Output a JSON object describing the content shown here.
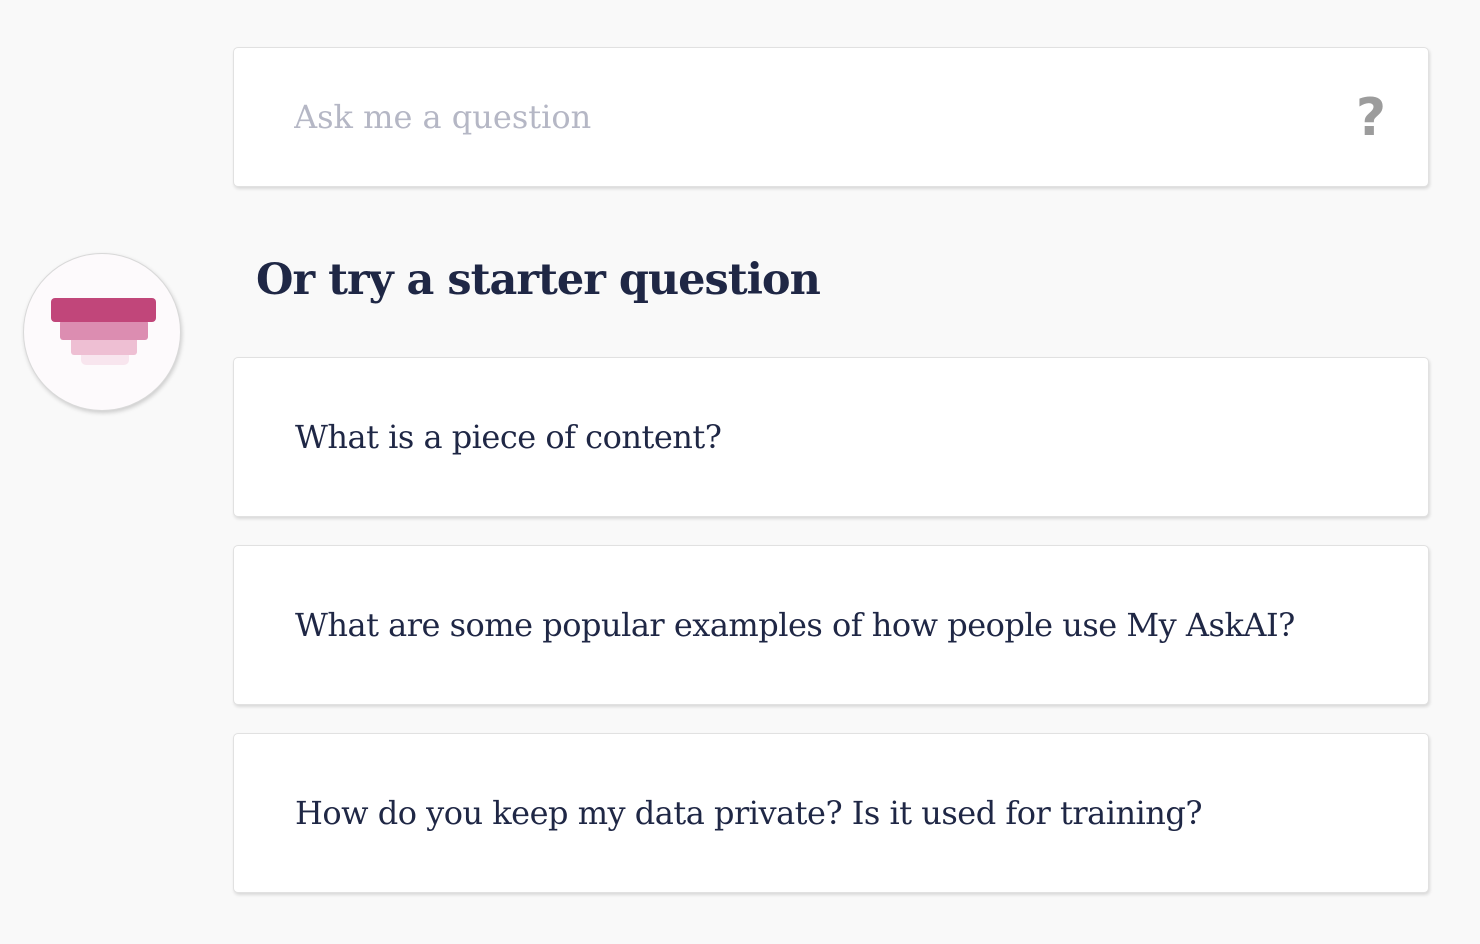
{
  "search": {
    "placeholder": "Ask me a question",
    "value": "",
    "help_icon": "?"
  },
  "avatar": {
    "icon": "stacked-layers-logo-icon",
    "colors": [
      "#c1467a",
      "#dc8db1",
      "#eebfd3",
      "#f8e5ee"
    ]
  },
  "starter": {
    "heading": "Or try a starter question",
    "questions": [
      "What is a piece of content?",
      "What are some popular examples of how people use My AskAI?",
      "How do you keep my data private? Is it used for training?"
    ]
  },
  "colors": {
    "background": "#f9f9f9",
    "text": "#1f2745",
    "placeholder": "#b5b7c5",
    "accent": "#c1467a"
  }
}
